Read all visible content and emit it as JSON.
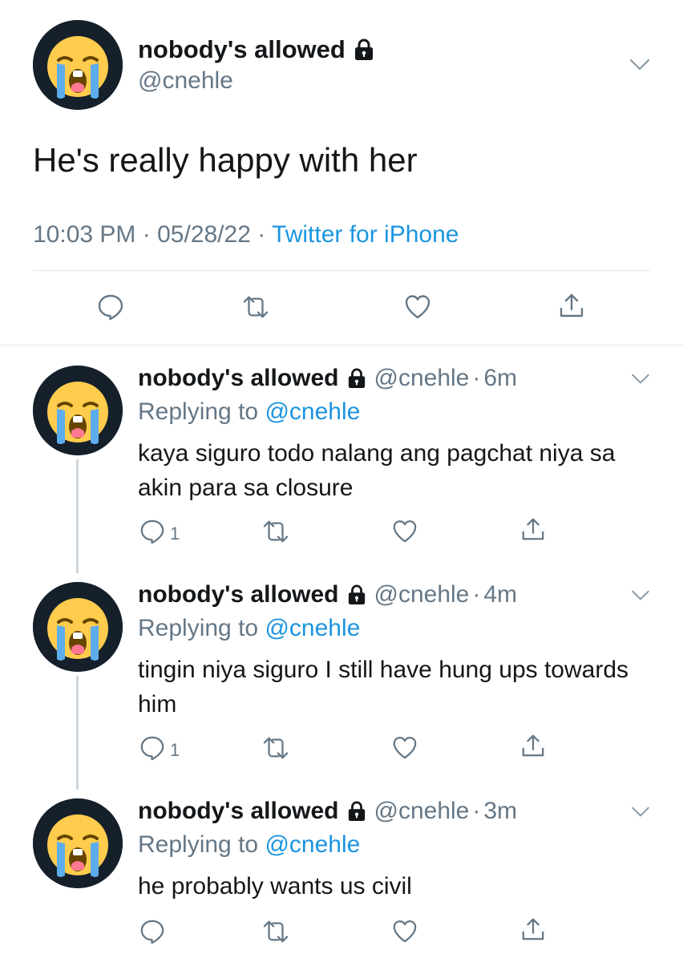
{
  "main_tweet": {
    "display_name": "nobody's allowed",
    "handle": "@cnehle",
    "text": "He's really happy with her",
    "time": "10:03 PM",
    "date": "05/28/22",
    "source": "Twitter for iPhone",
    "separator": "·"
  },
  "replies": [
    {
      "display_name": "nobody's allowed",
      "handle": "@cnehle",
      "separator": "·",
      "time": "6m",
      "replying_prefix": "Replying to",
      "replying_to": "@cnehle",
      "text": "kaya siguro todo nalang ang pagchat niya sa akin para sa closure",
      "reply_count": "1"
    },
    {
      "display_name": "nobody's allowed",
      "handle": "@cnehle",
      "separator": "·",
      "time": "4m",
      "replying_prefix": "Replying to",
      "replying_to": "@cnehle",
      "text": "tingin niya siguro I still have hung ups towards him",
      "reply_count": "1"
    },
    {
      "display_name": "nobody's allowed",
      "handle": "@cnehle",
      "separator": "·",
      "time": "3m",
      "replying_prefix": "Replying to",
      "replying_to": "@cnehle",
      "text": "he probably wants us civil",
      "reply_count": ""
    }
  ],
  "icons": {
    "avatar": "loudly-crying-face-emoji",
    "lock": "lock-icon",
    "menu": "chevron-down-icon",
    "reply": "reply-icon",
    "retweet": "retweet-icon",
    "like": "heart-icon",
    "share": "share-icon"
  },
  "colors": {
    "text": "#14171a",
    "secondary": "#657786",
    "link": "#1b95e0",
    "divider": "#e1e8ed",
    "thread_line": "#ccd6dd",
    "avatar_bg": "#15202b"
  }
}
